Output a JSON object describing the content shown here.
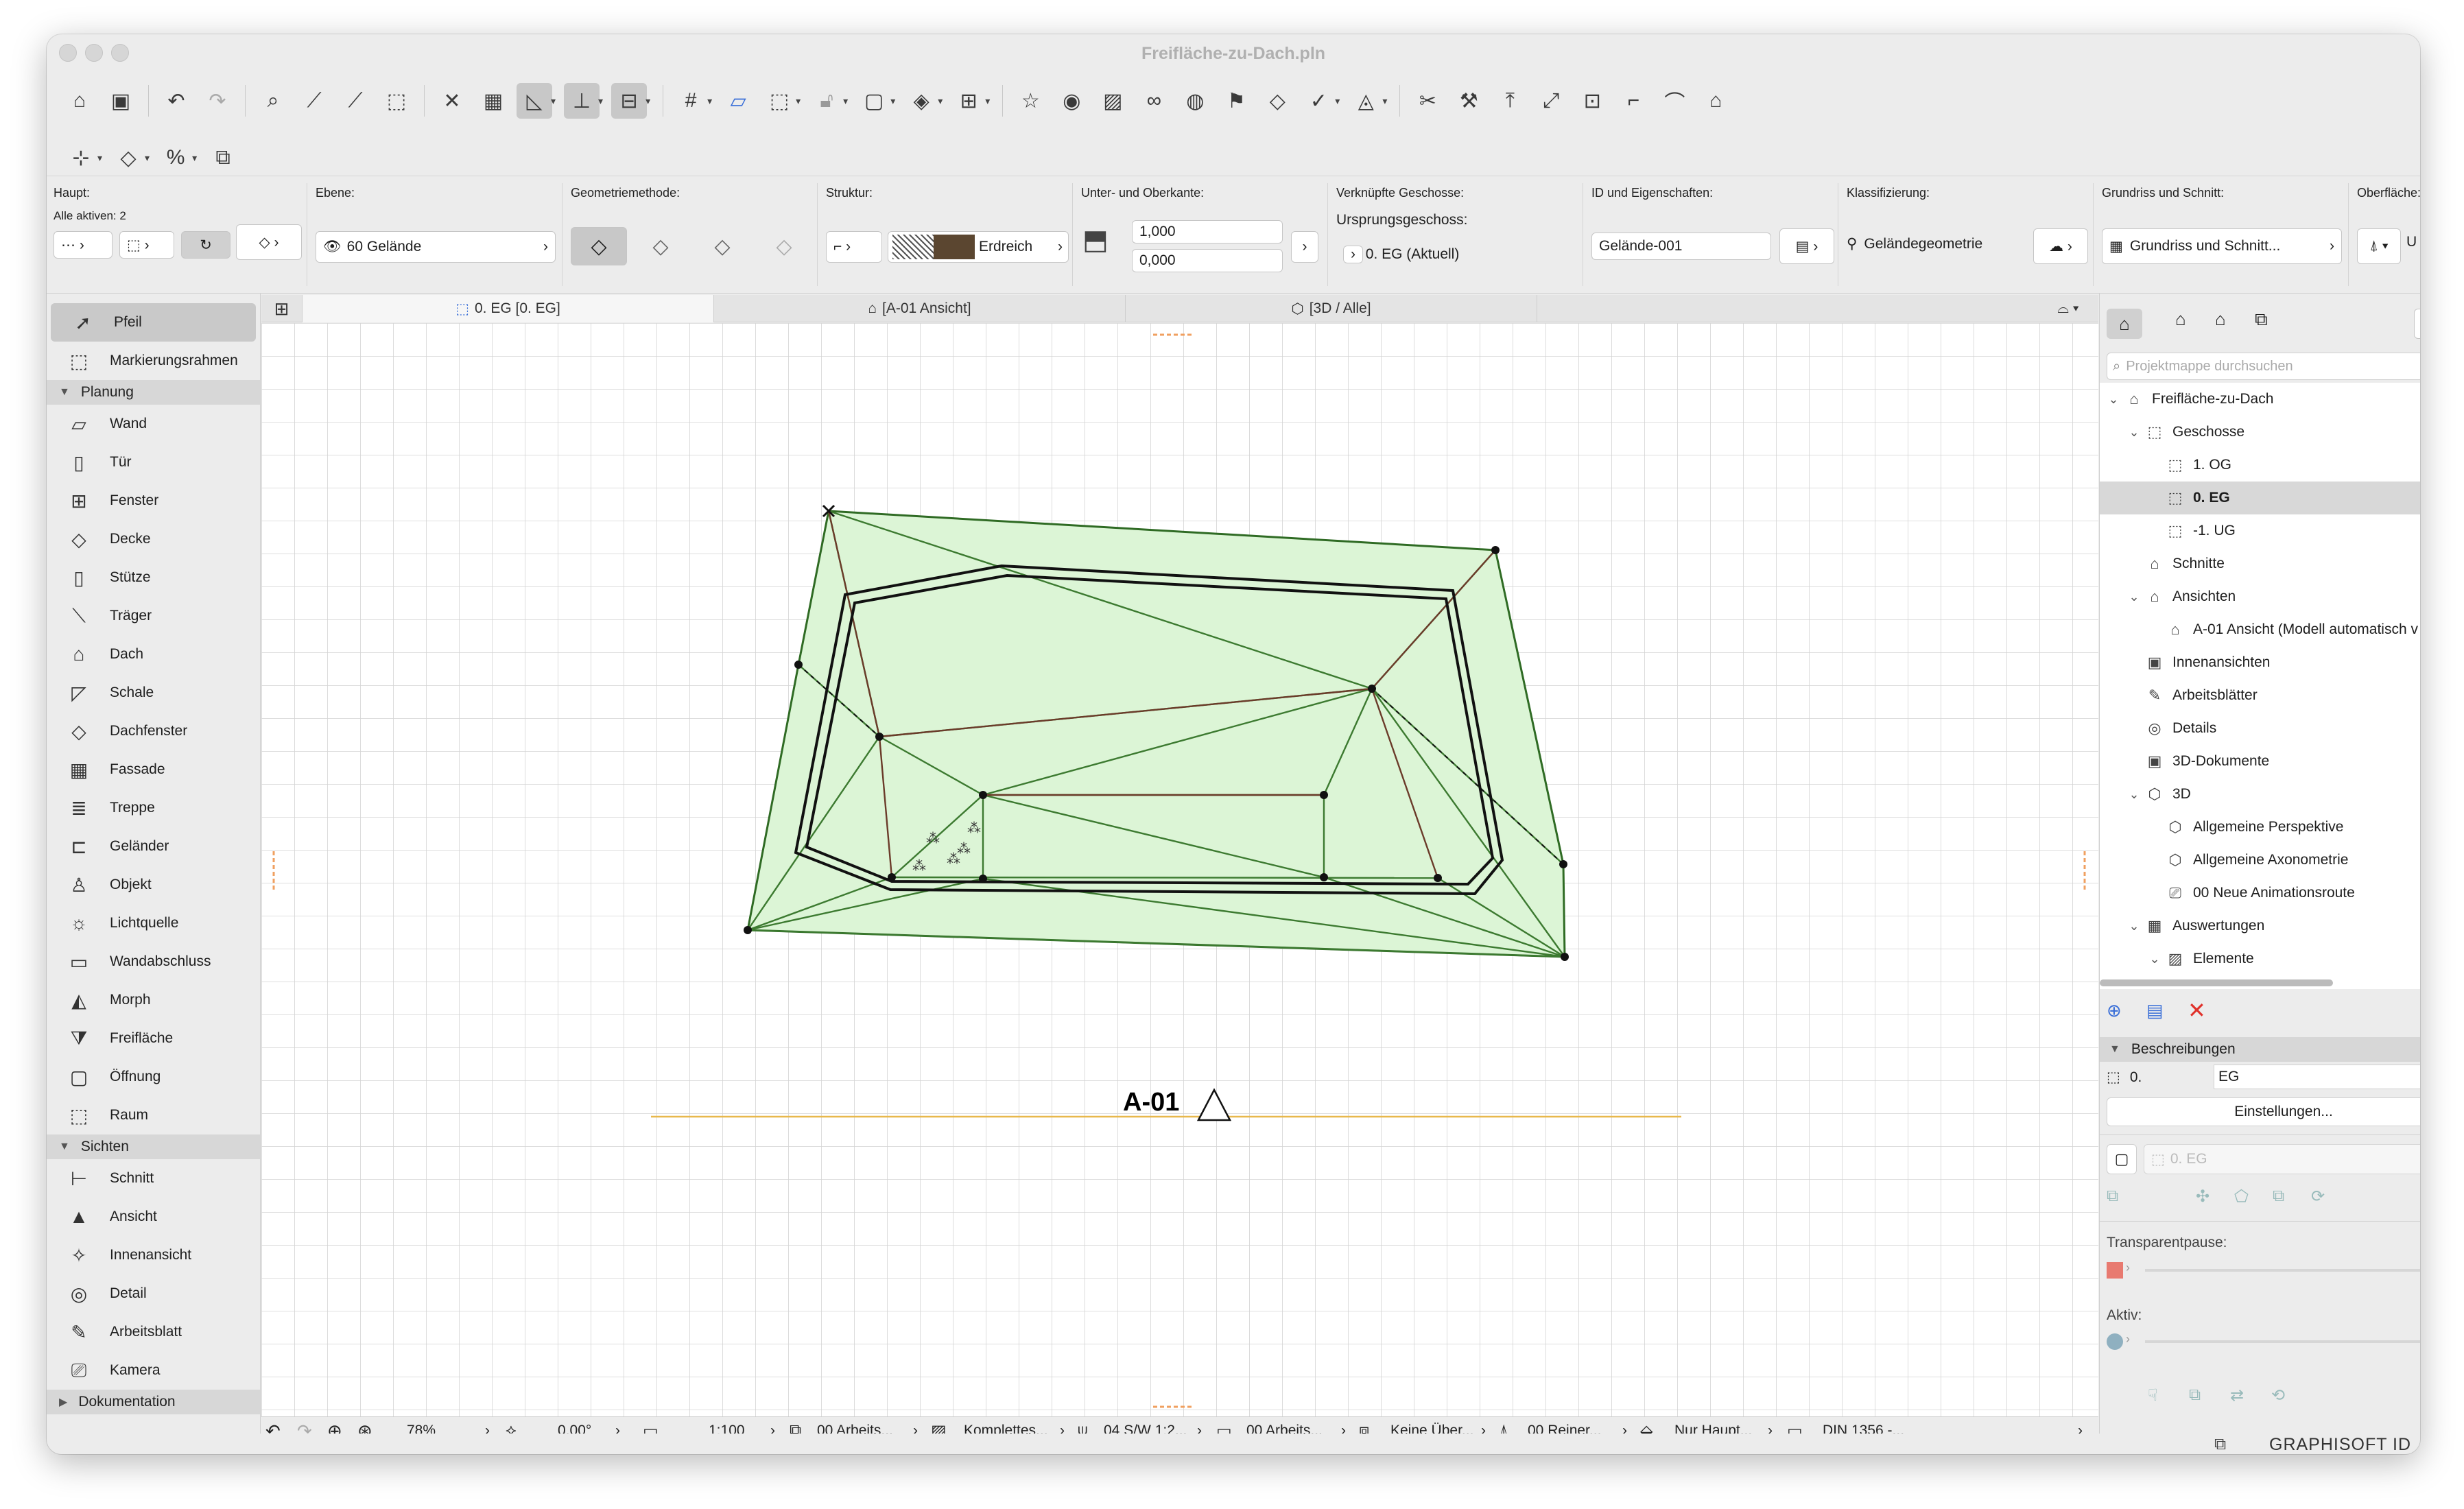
{
  "window": {
    "title": "Freifläche-zu-Dach.pln"
  },
  "infobox": {
    "haupt": {
      "label": "Haupt:",
      "sub": "Alle aktiven: 2"
    },
    "ebene": {
      "label": "Ebene:",
      "value": "60 Gelände"
    },
    "geometrie": {
      "label": "Geometriemethode:"
    },
    "struktur": {
      "label": "Struktur:",
      "value": "Erdreich"
    },
    "kanten": {
      "label": "Unter- und Oberkante:",
      "top": "1,000",
      "bottom": "0,000"
    },
    "geschosse": {
      "label": "Verknüpfte Geschosse:",
      "sub": "Ursprungsgeschoss:",
      "value": "0. EG (Aktuell)"
    },
    "id": {
      "label": "ID und Eigenschaften:",
      "value": "Gelände-001"
    },
    "klass": {
      "label": "Klassifizierung:",
      "value": "Geländegeometrie"
    },
    "grundriss": {
      "label": "Grundriss und Schnitt:",
      "value": "Grundriss und Schnitt..."
    },
    "oberflaeche": {
      "label": "Oberfläche:",
      "value": "U"
    }
  },
  "toolbox": {
    "top": [
      {
        "label": "Pfeil",
        "icon": "arrow-icon"
      },
      {
        "label": "Markierungsrahmen",
        "icon": "marquee-icon"
      }
    ],
    "planung_label": "Planung",
    "planung": [
      "Wand",
      "Tür",
      "Fenster",
      "Decke",
      "Stütze",
      "Träger",
      "Dach",
      "Schale",
      "Dachfenster",
      "Fassade",
      "Treppe",
      "Geländer",
      "Objekt",
      "Lichtquelle",
      "Wandabschluss",
      "Morph",
      "Freifläche",
      "Öffnung",
      "Raum"
    ],
    "sichten_label": "Sichten",
    "sichten": [
      "Schnitt",
      "Ansicht",
      "Innenansicht",
      "Detail",
      "Arbeitsblatt",
      "Kamera"
    ],
    "dokumentation_label": "Dokumentation"
  },
  "tabs": [
    "0. EG [0. EG]",
    "[A-01 Ansicht]",
    "[3D / Alle]"
  ],
  "canvas": {
    "elevation_marker": "A-01"
  },
  "statusbar": {
    "zoom": "78%",
    "angle": "0,00°",
    "scale": "1:100",
    "layers": "00 Arbeits...",
    "model": "Komplettes...",
    "pen": "04 S/W 1:2...",
    "dim": "00 Arbeits...",
    "override": "Keine Über...",
    "renov": "00 Reiner...",
    "structure": "Nur Haupt...",
    "din": "DIN 1356 -..."
  },
  "navigator": {
    "search_placeholder": "Projektmappe durchsuchen",
    "tree": [
      {
        "label": "Freifläche-zu-Dach",
        "level": 0,
        "chev": "⌄",
        "icon": "house-icon"
      },
      {
        "label": "Geschosse",
        "level": 1,
        "chev": "⌄",
        "icon": "story-icon"
      },
      {
        "label": "1. OG",
        "level": 2,
        "chev": "",
        "icon": "story-icon"
      },
      {
        "label": "0. EG",
        "level": 2,
        "chev": "",
        "icon": "story-icon",
        "selected": true
      },
      {
        "label": "-1. UG",
        "level": 2,
        "chev": "",
        "icon": "story-icon"
      },
      {
        "label": "Schnitte",
        "level": 1,
        "chev": "",
        "icon": "section-icon"
      },
      {
        "label": "Ansichten",
        "level": 1,
        "chev": "⌄",
        "icon": "elevation-icon"
      },
      {
        "label": "A-01 Ansicht (Modell automatisch v",
        "level": 2,
        "chev": "",
        "icon": "elevation-icon"
      },
      {
        "label": "Innenansichten",
        "level": 1,
        "chev": "",
        "icon": "interior-icon"
      },
      {
        "label": "Arbeitsblätter",
        "level": 1,
        "chev": "",
        "icon": "worksheet-icon"
      },
      {
        "label": "Details",
        "level": 1,
        "chev": "",
        "icon": "detail-icon"
      },
      {
        "label": "3D-Dokumente",
        "level": 1,
        "chev": "",
        "icon": "3d-doc-icon"
      },
      {
        "label": "3D",
        "level": 1,
        "chev": "⌄",
        "icon": "cube-icon"
      },
      {
        "label": "Allgemeine Perspektive",
        "level": 2,
        "chev": "",
        "icon": "cube-icon"
      },
      {
        "label": "Allgemeine Axonometrie",
        "level": 2,
        "chev": "",
        "icon": "cube-icon"
      },
      {
        "label": "00 Neue Animationsroute",
        "level": 2,
        "chev": "",
        "icon": "camera-icon"
      },
      {
        "label": "Auswertungen",
        "level": 1,
        "chev": "⌄",
        "icon": "table-icon"
      },
      {
        "label": "Elemente",
        "level": 2,
        "chev": "⌄",
        "icon": "elements-icon"
      }
    ],
    "beschreibungen": "Beschreibungen",
    "story_number": "0.",
    "story_name": "EG",
    "settings_button": "Einstellungen...",
    "story_select": "0. EG",
    "transparent_label": "Transparentpause:",
    "aktiv_label": "Aktiv:"
  },
  "footer": {
    "brand": "GRAPHISOFT ID"
  }
}
